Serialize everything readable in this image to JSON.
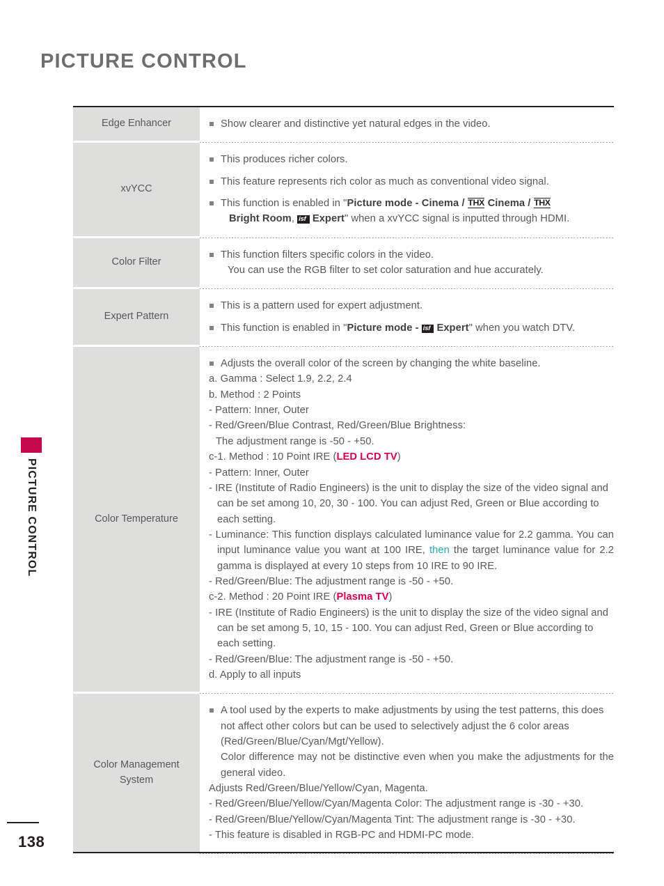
{
  "page": {
    "title": "PICTURE CONTROL",
    "side_label": "PICTURE CONTROL",
    "number": "138"
  },
  "colors": {
    "accent_tab": "#c8084c",
    "pink_text": "#d4004f",
    "teal_text": "#2aa8b0",
    "label_cell_bg": "#dededd",
    "body_text": "#58585a"
  },
  "marks": {
    "thx": "THX",
    "isf": "isf"
  },
  "table": {
    "rows": [
      {
        "label": "Edge Enhancer",
        "lines": {
          "l1": "Show clearer and distinctive yet natural edges in the video."
        }
      },
      {
        "label": "xvYCC",
        "lines": {
          "l1": "This produces richer colors.",
          "l2": "This feature represents rich color as much as conventional video signal.",
          "l3a": "This function is enabled in \"",
          "l3b": "Picture mode",
          "l3c": " - ",
          "l3d": "Cinema",
          "l3e": " / ",
          "l3f": "Cinema",
          "l3g": " / ",
          "l3h": "Bright Room",
          "l3i": ", ",
          "l3j": "Expert",
          "l3k": "\" when a xvYCC signal is inputted through HDMI."
        }
      },
      {
        "label": "Color Filter",
        "lines": {
          "l1": "This function filters specific colors in the video.",
          "l2": "You can use the RGB filter to set color saturation and hue accurately."
        }
      },
      {
        "label": "Expert Pattern",
        "lines": {
          "l1": "This is a pattern used for expert adjustment.",
          "l2a": "This function is enabled in \"",
          "l2b": "Picture mode",
          "l2c": " - ",
          "l2d": "Expert",
          "l2e": "\" when you watch DTV."
        }
      },
      {
        "label": "Color Temperature",
        "lines": {
          "l1": "Adjusts the overall color of the screen by changing the white baseline.",
          "l2": "a. Gamma : Select 1.9, 2.2, 2.4",
          "l3": "b. Method : 2 Points",
          "l4": "- Pattern: Inner, Outer",
          "l5": "- Red/Green/Blue Contrast, Red/Green/Blue Brightness:",
          "l6": "The adjustment range is -50 - +50.",
          "l7a": "c-1. Method : 10 Point IRE (",
          "l7b": "LED LCD TV",
          "l7c": ")",
          "l8": "- Pattern: Inner, Outer",
          "l9": "- IRE (Institute of Radio Engineers) is the unit to display the size of the video signal and can be set among 10, 20, 30 - 100. You can adjust Red, Green or Blue according to each setting.",
          "l10a": "- Luminance: This function displays calculated luminance value for 2.2 gamma. You can input luminance value you want at 100 IRE, ",
          "l10b": "then",
          "l10c": " the target luminance value for 2.2 gamma is displayed at every 10 steps from 10 IRE to 90 IRE.",
          "l11": "- Red/Green/Blue: The adjustment range is -50 - +50.",
          "l12a": "c-2. Method : 20 Point IRE (",
          "l12b": "Plasma TV",
          "l12c": ")",
          "l13": "- IRE (Institute of Radio Engineers) is the unit to display the size of the video signal and can be set among 5, 10, 15 - 100. You can adjust Red, Green or Blue according to each setting.",
          "l14": "- Red/Green/Blue: The adjustment range is -50 - +50.",
          "l15": "d. Apply to all inputs"
        }
      },
      {
        "label": "Color Management System",
        "lines": {
          "l1": "A tool used by the experts to make adjustments by using the test patterns, this does not affect other colors but can be used to selectively adjust the 6 color areas (Red/Green/Blue/Cyan/Mgt/Yellow).",
          "l2": "Color difference may not be distinctive even when you make the adjustments for the general video.",
          "l3": "Adjusts Red/Green/Blue/Yellow/Cyan, Magenta.",
          "l4": "- Red/Green/Blue/Yellow/Cyan/Magenta Color: The adjustment range is -30 - +30.",
          "l5": "- Red/Green/Blue/Yellow/Cyan/Magenta Tint: The adjustment range is -30 - +30.",
          "l6": "- This feature is disabled in RGB-PC and HDMI-PC mode."
        }
      }
    ]
  }
}
